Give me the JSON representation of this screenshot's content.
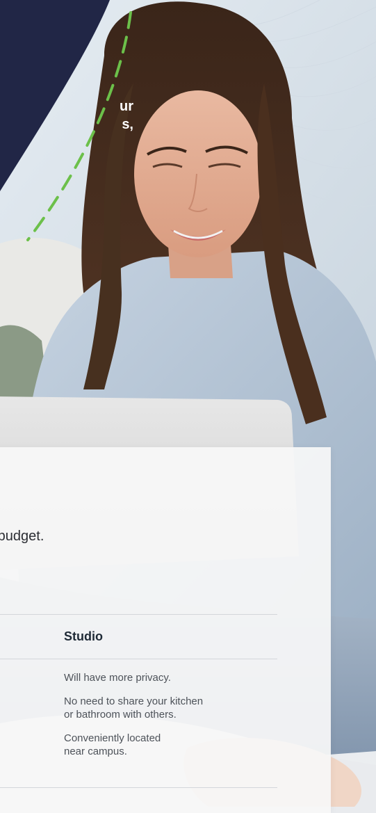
{
  "hero": {
    "text_lines": [
      "ur",
      "s,"
    ],
    "colors": {
      "panel": "#212646",
      "dash": "#6cc04a"
    }
  },
  "card": {
    "intro_text": "d budget.",
    "studio": {
      "title": "Studio",
      "benefits": [
        {
          "lines": [
            "Will have more privacy."
          ]
        },
        {
          "lines": [
            "No need to share your kitchen",
            "or bathroom with others."
          ]
        },
        {
          "lines": [
            "Conveniently located",
            "near campus."
          ]
        }
      ]
    }
  }
}
